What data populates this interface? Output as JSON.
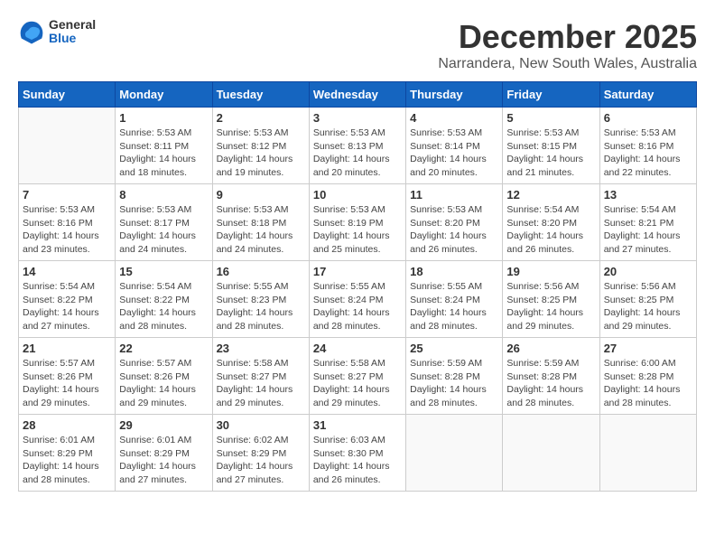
{
  "logo": {
    "general": "General",
    "blue": "Blue"
  },
  "title": "December 2025",
  "location": "Narrandera, New South Wales, Australia",
  "days_header": [
    "Sunday",
    "Monday",
    "Tuesday",
    "Wednesday",
    "Thursday",
    "Friday",
    "Saturday"
  ],
  "weeks": [
    [
      {
        "day": "",
        "info": ""
      },
      {
        "day": "1",
        "info": "Sunrise: 5:53 AM\nSunset: 8:11 PM\nDaylight: 14 hours\nand 18 minutes."
      },
      {
        "day": "2",
        "info": "Sunrise: 5:53 AM\nSunset: 8:12 PM\nDaylight: 14 hours\nand 19 minutes."
      },
      {
        "day": "3",
        "info": "Sunrise: 5:53 AM\nSunset: 8:13 PM\nDaylight: 14 hours\nand 20 minutes."
      },
      {
        "day": "4",
        "info": "Sunrise: 5:53 AM\nSunset: 8:14 PM\nDaylight: 14 hours\nand 20 minutes."
      },
      {
        "day": "5",
        "info": "Sunrise: 5:53 AM\nSunset: 8:15 PM\nDaylight: 14 hours\nand 21 minutes."
      },
      {
        "day": "6",
        "info": "Sunrise: 5:53 AM\nSunset: 8:16 PM\nDaylight: 14 hours\nand 22 minutes."
      }
    ],
    [
      {
        "day": "7",
        "info": "Sunrise: 5:53 AM\nSunset: 8:16 PM\nDaylight: 14 hours\nand 23 minutes."
      },
      {
        "day": "8",
        "info": "Sunrise: 5:53 AM\nSunset: 8:17 PM\nDaylight: 14 hours\nand 24 minutes."
      },
      {
        "day": "9",
        "info": "Sunrise: 5:53 AM\nSunset: 8:18 PM\nDaylight: 14 hours\nand 24 minutes."
      },
      {
        "day": "10",
        "info": "Sunrise: 5:53 AM\nSunset: 8:19 PM\nDaylight: 14 hours\nand 25 minutes."
      },
      {
        "day": "11",
        "info": "Sunrise: 5:53 AM\nSunset: 8:20 PM\nDaylight: 14 hours\nand 26 minutes."
      },
      {
        "day": "12",
        "info": "Sunrise: 5:54 AM\nSunset: 8:20 PM\nDaylight: 14 hours\nand 26 minutes."
      },
      {
        "day": "13",
        "info": "Sunrise: 5:54 AM\nSunset: 8:21 PM\nDaylight: 14 hours\nand 27 minutes."
      }
    ],
    [
      {
        "day": "14",
        "info": "Sunrise: 5:54 AM\nSunset: 8:22 PM\nDaylight: 14 hours\nand 27 minutes."
      },
      {
        "day": "15",
        "info": "Sunrise: 5:54 AM\nSunset: 8:22 PM\nDaylight: 14 hours\nand 28 minutes."
      },
      {
        "day": "16",
        "info": "Sunrise: 5:55 AM\nSunset: 8:23 PM\nDaylight: 14 hours\nand 28 minutes."
      },
      {
        "day": "17",
        "info": "Sunrise: 5:55 AM\nSunset: 8:24 PM\nDaylight: 14 hours\nand 28 minutes."
      },
      {
        "day": "18",
        "info": "Sunrise: 5:55 AM\nSunset: 8:24 PM\nDaylight: 14 hours\nand 28 minutes."
      },
      {
        "day": "19",
        "info": "Sunrise: 5:56 AM\nSunset: 8:25 PM\nDaylight: 14 hours\nand 29 minutes."
      },
      {
        "day": "20",
        "info": "Sunrise: 5:56 AM\nSunset: 8:25 PM\nDaylight: 14 hours\nand 29 minutes."
      }
    ],
    [
      {
        "day": "21",
        "info": "Sunrise: 5:57 AM\nSunset: 8:26 PM\nDaylight: 14 hours\nand 29 minutes."
      },
      {
        "day": "22",
        "info": "Sunrise: 5:57 AM\nSunset: 8:26 PM\nDaylight: 14 hours\nand 29 minutes."
      },
      {
        "day": "23",
        "info": "Sunrise: 5:58 AM\nSunset: 8:27 PM\nDaylight: 14 hours\nand 29 minutes."
      },
      {
        "day": "24",
        "info": "Sunrise: 5:58 AM\nSunset: 8:27 PM\nDaylight: 14 hours\nand 29 minutes."
      },
      {
        "day": "25",
        "info": "Sunrise: 5:59 AM\nSunset: 8:28 PM\nDaylight: 14 hours\nand 28 minutes."
      },
      {
        "day": "26",
        "info": "Sunrise: 5:59 AM\nSunset: 8:28 PM\nDaylight: 14 hours\nand 28 minutes."
      },
      {
        "day": "27",
        "info": "Sunrise: 6:00 AM\nSunset: 8:28 PM\nDaylight: 14 hours\nand 28 minutes."
      }
    ],
    [
      {
        "day": "28",
        "info": "Sunrise: 6:01 AM\nSunset: 8:29 PM\nDaylight: 14 hours\nand 28 minutes."
      },
      {
        "day": "29",
        "info": "Sunrise: 6:01 AM\nSunset: 8:29 PM\nDaylight: 14 hours\nand 27 minutes."
      },
      {
        "day": "30",
        "info": "Sunrise: 6:02 AM\nSunset: 8:29 PM\nDaylight: 14 hours\nand 27 minutes."
      },
      {
        "day": "31",
        "info": "Sunrise: 6:03 AM\nSunset: 8:30 PM\nDaylight: 14 hours\nand 26 minutes."
      },
      {
        "day": "",
        "info": ""
      },
      {
        "day": "",
        "info": ""
      },
      {
        "day": "",
        "info": ""
      }
    ]
  ]
}
